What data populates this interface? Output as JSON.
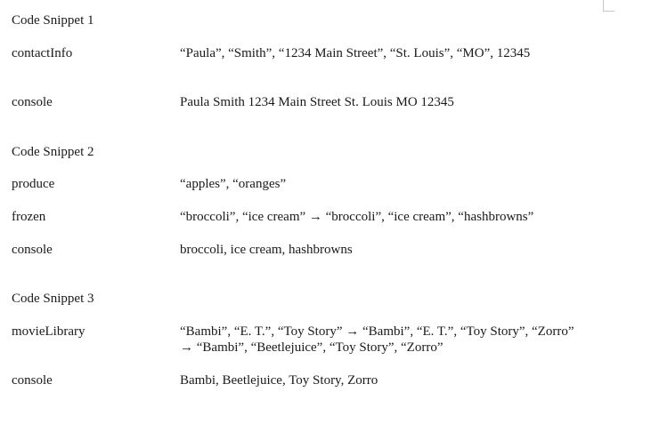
{
  "snippets": [
    {
      "heading": "Code Snippet 1",
      "rows": [
        {
          "label": "contactInfo",
          "lines": [
            "“Paula”, “Smith”, “1234 Main Street”, “St. Louis”, “MO”, 12345"
          ]
        },
        {
          "label": "console",
          "lines": [
            "Paula Smith 1234 Main Street St. Louis MO 12345"
          ]
        }
      ]
    },
    {
      "heading": "Code Snippet 2",
      "rows": [
        {
          "label": "produce",
          "lines": [
            "“apples”, “oranges”"
          ]
        },
        {
          "label": "frozen",
          "lines": [
            "“broccoli”, “ice cream” → “broccoli”, “ice cream”, “hashbrowns”"
          ]
        },
        {
          "label": "console",
          "lines": [
            "broccoli, ice cream, hashbrowns"
          ]
        }
      ]
    },
    {
      "heading": "Code Snippet 3",
      "rows": [
        {
          "label": "movieLibrary",
          "lines": [
            "“Bambi”, “E. T.”, “Toy Story” → “Bambi”, “E. T.”, “Toy Story”, “Zorro”",
            "→ “Bambi”, “Beetlejuice”, “Toy Story”, “Zorro”"
          ]
        },
        {
          "label": "console",
          "lines": [
            "Bambi, Beetlejuice, Toy Story, Zorro"
          ]
        }
      ]
    }
  ]
}
